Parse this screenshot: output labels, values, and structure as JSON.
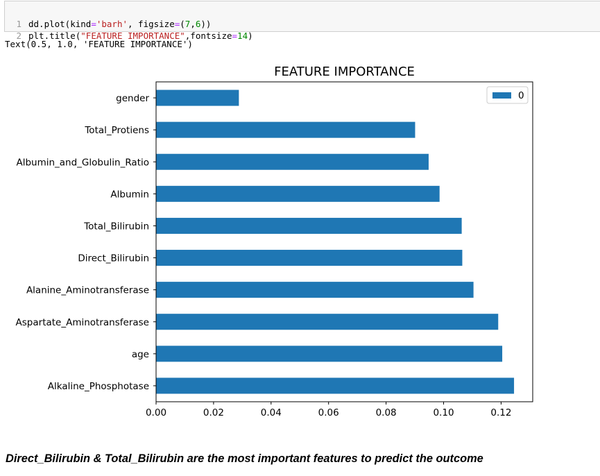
{
  "cell": {
    "line1": {
      "number": "1",
      "tokens": [
        "dd.plot(kind",
        "=",
        "'barh'",
        ", figsize",
        "=",
        "(",
        "7",
        ",",
        "6",
        "))"
      ]
    },
    "line2": {
      "number": "2",
      "tokens": [
        "plt.title(",
        "\"FEATURE IMPORTANCE\"",
        ",fontsize",
        "=",
        "14",
        ")"
      ]
    }
  },
  "output": {
    "text": "Text(0.5, 1.0, 'FEATURE IMPORTANCE')"
  },
  "colors": {
    "bar": "#1f77b4",
    "string": "#ba2121",
    "operator": "#aa22ff",
    "number": "#008800"
  },
  "chart_data": {
    "type": "bar",
    "orientation": "horizontal",
    "title": "FEATURE IMPORTANCE",
    "xlabel": "",
    "ylabel": "",
    "categories": [
      "Alkaline_Phosphotase",
      "age",
      "Aspartate_Aminotransferase",
      "Alanine_Aminotransferase",
      "Direct_Bilirubin",
      "Total_Bilirubin",
      "Albumin",
      "Albumin_and_Globulin_Ratio",
      "Total_Protiens",
      "gender"
    ],
    "series": [
      {
        "name": "0",
        "values": [
          0.1245,
          0.1204,
          0.119,
          0.1104,
          0.1065,
          0.1063,
          0.0986,
          0.0948,
          0.0901,
          0.0288
        ]
      }
    ],
    "xlim": [
      0,
      0.131
    ],
    "xticks": [
      0.0,
      0.02,
      0.04,
      0.06,
      0.08,
      0.1,
      0.12
    ],
    "xtick_labels": [
      "0.00",
      "0.02",
      "0.04",
      "0.06",
      "0.08",
      "0.10",
      "0.12"
    ],
    "legend": {
      "placement": "top-right",
      "entries": [
        "0"
      ]
    },
    "grid": false
  },
  "conclusion": {
    "text": "Direct_Bilirubin & Total_Bilirubin are the most important features to predict the outcome"
  }
}
